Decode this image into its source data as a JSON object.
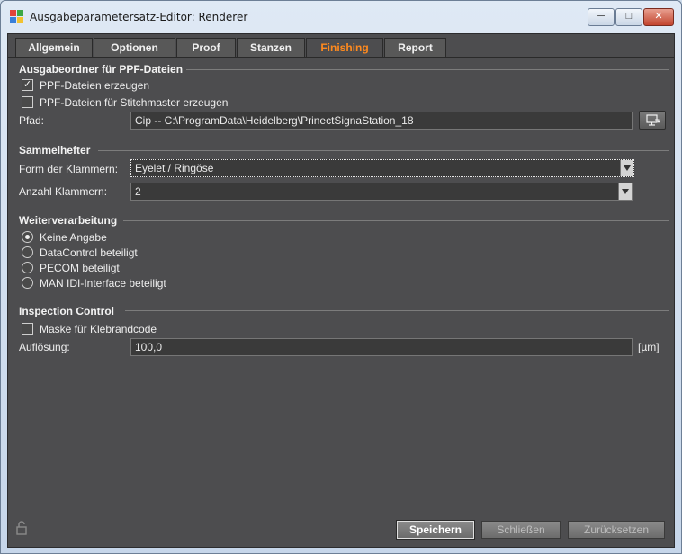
{
  "window": {
    "title": "Ausgabeparametersatz-Editor: Renderer"
  },
  "tabs": [
    "Allgemein",
    "Optionen",
    "Proof",
    "Stanzen",
    "Finishing",
    "Report"
  ],
  "active_tab": "Finishing",
  "ppf": {
    "title": "Ausgabeordner für PPF-Dateien",
    "create_label": "PPF-Dateien erzeugen",
    "create_checked": true,
    "stitch_label": "PPF-Dateien für Stitchmaster erzeugen",
    "stitch_checked": false,
    "path_label": "Pfad:",
    "path_value": "Cip -- C:\\ProgramData\\Heidelberg\\PrinectSignaStation_18"
  },
  "sammelhefter": {
    "title": "Sammelhefter",
    "form_label": "Form der Klammern:",
    "form_value": "Eyelet / Ringöse",
    "count_label": "Anzahl Klammern:",
    "count_value": "2"
  },
  "weiter": {
    "title": "Weiterverarbeitung",
    "options": [
      "Keine Angabe",
      "DataControl beteiligt",
      "PECOM beteiligt",
      "MAN IDI-Interface beteiligt"
    ],
    "selected": "Keine Angabe"
  },
  "inspection": {
    "title": "Inspection Control",
    "mask_label": "Maske für Klebrandcode",
    "mask_checked": false,
    "resolution_label": "Auflösung:",
    "resolution_value": "100,0",
    "unit": "[µm]"
  },
  "buttons": {
    "save": "Speichern",
    "close": "Schließen",
    "reset": "Zurücksetzen"
  },
  "colors": {
    "background": "#4d4d4f",
    "active_tab_text": "#ff8a1e"
  }
}
